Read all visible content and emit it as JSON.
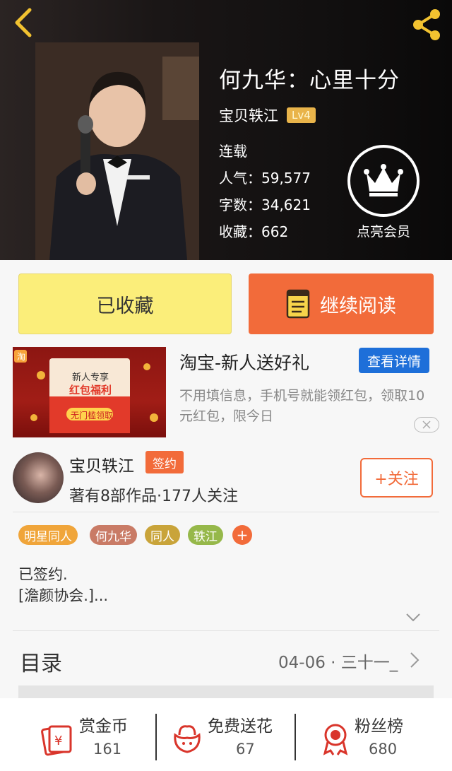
{
  "book": {
    "title": "何九华：心里十分",
    "author": "宝贝轶江",
    "level": "Lv4",
    "status": "连载",
    "popularity": "人气：59,577",
    "word_count": "字数：34,621",
    "collections": "收藏：662"
  },
  "vip": {
    "label": "点亮会员"
  },
  "actions": {
    "favorited": "已收藏",
    "continue_reading": "继续阅读"
  },
  "ad": {
    "title": "淘宝-新人送好礼",
    "detail_button": "查看详情",
    "description": "不用填信息，手机号就能领红包，领取10元红包，限今日",
    "image_text": {
      "line1": "新人专享",
      "line2": "红包福利",
      "line3": "无门槛领取"
    }
  },
  "author_card": {
    "name": "宝贝轶江",
    "badge": "签约",
    "works": "著有8部作品·177人关注",
    "follow_button": "+关注"
  },
  "tags": [
    {
      "label": "明星同人",
      "color": "#f0a53a"
    },
    {
      "label": "何九华",
      "color": "#c97b66"
    },
    {
      "label": "同人",
      "color": "#c9a43a"
    },
    {
      "label": "轶江",
      "color": "#96b84a"
    }
  ],
  "tag_add": "+",
  "intro": {
    "line1": "已签约.",
    "line2": "[澹颜协会.]..."
  },
  "catalog": {
    "label": "目录",
    "latest": "04-06 · 三十一_"
  },
  "bottom_bar": [
    {
      "label": "赏金币",
      "count": "161",
      "icon": "reward-coin-icon"
    },
    {
      "label": "免费送花",
      "count": "67",
      "icon": "flower-icon"
    },
    {
      "label": "粉丝榜",
      "count": "680",
      "icon": "medal-icon"
    }
  ],
  "colors": {
    "accent": "#f26b3a",
    "favorite_bg": "#fbee7a",
    "ad_button": "#1e6fd9",
    "icon_red": "#d9352b"
  }
}
